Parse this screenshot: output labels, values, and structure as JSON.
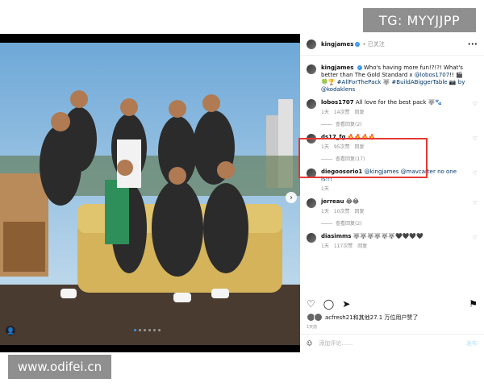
{
  "watermark": {
    "top": "TG: MYYJJPP",
    "bottom": "www.odifei.cn"
  },
  "post": {
    "username": "kingjames",
    "follow_status": "• 已关注",
    "caption": {
      "username": "kingjames",
      "text": "Who's having more fun!?!?! What's better than The Gold Standard x",
      "mention": "@lobos1707",
      "suffix": "!! 🎬🍀🏆",
      "hashtags": "#AllForThePack 🐺 #BuildABiggerTable 📷 by",
      "photographer": "@kodaklens"
    },
    "comments": [
      {
        "username": "lobos1707",
        "text": "All love for the best pack 🐺🐾",
        "time": "1天",
        "likes": "14次赞",
        "reply": "回复",
        "view_replies": "查看回复(2)"
      },
      {
        "username": "ds17_fg",
        "text": "🔥🔥🔥🔥",
        "time": "1天",
        "likes": "95次赞",
        "reply": "回复",
        "view_replies": "查看回复(17)"
      },
      {
        "username": "diegoosorio1",
        "text": "@kingjames @mavcarter no one is!!!",
        "time": "1天",
        "likes": "",
        "reply": "",
        "view_replies": ""
      },
      {
        "username": "jerreau",
        "text": "😂😂",
        "time": "1天",
        "likes": "10次赞",
        "reply": "回复",
        "view_replies": "查看回复(2)"
      },
      {
        "username": "diasimms",
        "text": "🐺🐺🐺🐺🐺🐺🖤🖤🖤🖤",
        "time": "1天",
        "likes": "117次赞",
        "reply": "回复",
        "view_replies": ""
      }
    ],
    "likes_text": "acfresh21和其他27.1 万位用户赞了",
    "date": "1天前",
    "add_comment_placeholder": "添加评论……",
    "post_button": "发布"
  },
  "icons": [
    "heart-icon",
    "comment-icon",
    "share-icon",
    "bookmark-icon",
    "emoji-icon",
    "chevron-right-icon",
    "tag-person-icon",
    "verified-icon"
  ],
  "colors": {
    "highlight": "#e53935",
    "link": "#00376b",
    "verified": "#3897f0"
  }
}
